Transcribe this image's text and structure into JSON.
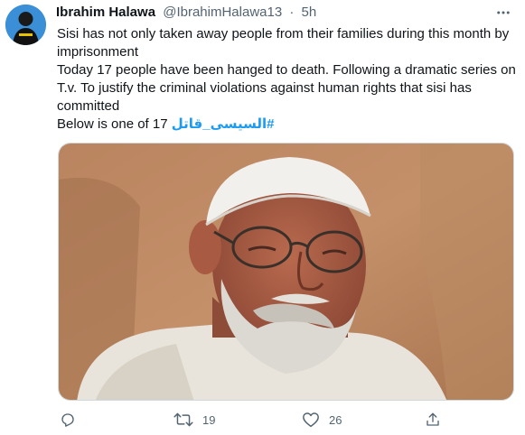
{
  "tweet": {
    "author_name": "Ibrahim Halawa",
    "author_handle": "@IbrahimHalawa13",
    "separator": "·",
    "timestamp": "5h",
    "avatar_icon": "profile-avatar",
    "more_icon": "more-horizontal-icon",
    "text_line1": "Sisi has not only taken away people from their families during this month by imprisonment",
    "text_line2": "Today 17 people have been hanged to death. Following a dramatic series on T.v. To justify the criminal violations against human rights that sisi has committed",
    "text_line3_prefix": "Below is one of 17 ",
    "hashtag": "#السيسى_قاتل",
    "image_alt_subject": "photo-elderly-man",
    "accent_color": "#1d9bf0"
  },
  "actions": {
    "reply_icon": "reply-icon",
    "reply_count": "",
    "retweet_icon": "retweet-icon",
    "retweet_count": "19",
    "like_icon": "heart-icon",
    "like_count": "26",
    "share_icon": "share-icon"
  }
}
